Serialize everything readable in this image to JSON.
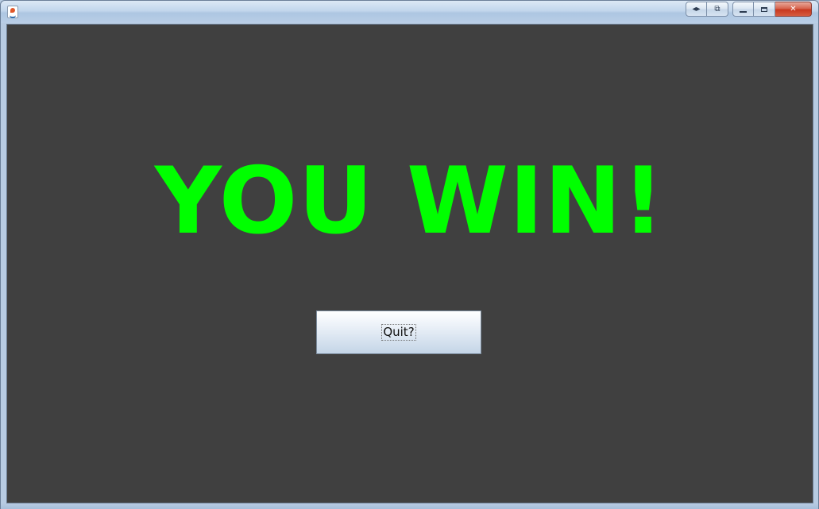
{
  "window": {
    "title": "",
    "controls": {
      "back_forward_glyph": "◂▸",
      "switch_glyph": "⧉",
      "close_glyph": "✕"
    }
  },
  "game": {
    "message": "YOU WIN!",
    "message_color": "#00ff00",
    "background_color": "#404040",
    "quit_label": "Quit?"
  }
}
